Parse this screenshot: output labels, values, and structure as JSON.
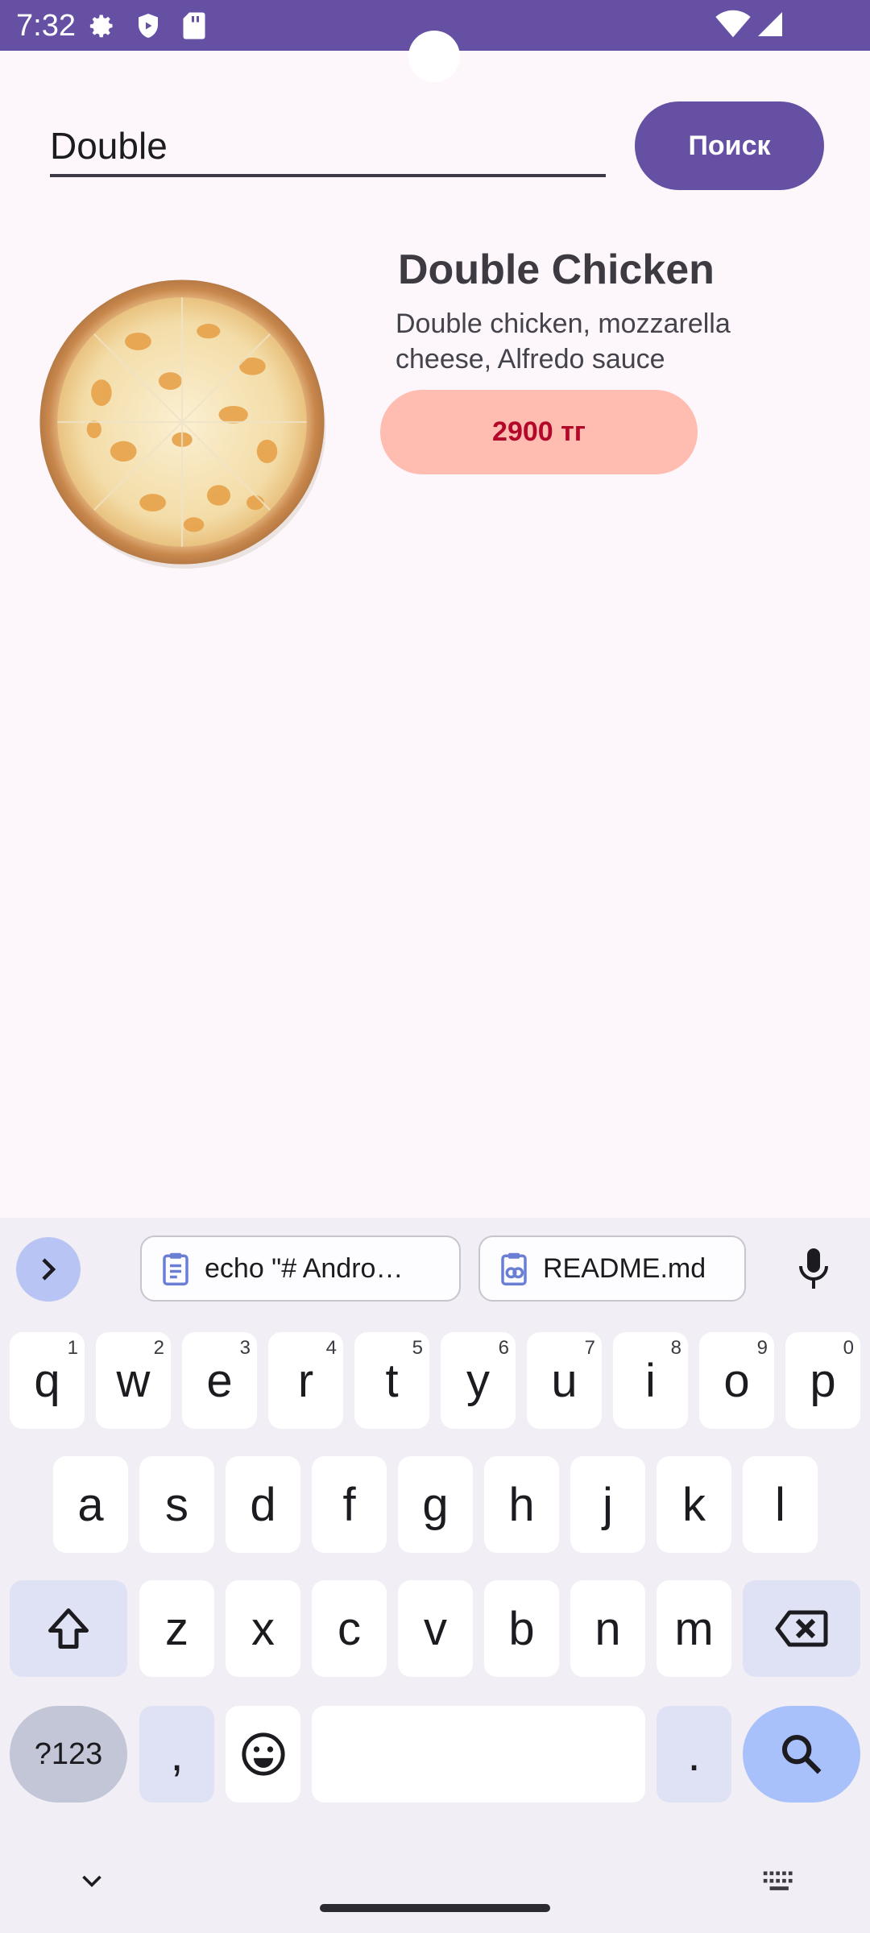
{
  "status_bar": {
    "time": "7:32",
    "icons": [
      "settings-icon",
      "shield-icon",
      "sd-card-icon",
      "wifi-icon",
      "signal-icon",
      "battery-icon"
    ]
  },
  "search": {
    "value": "Double",
    "button_label": "Поиск"
  },
  "product": {
    "title": "Double Chicken",
    "description": "Double chicken, mozzarella cheese, Alfredo sauce",
    "price": "2900 тг"
  },
  "keyboard": {
    "clipboard": [
      "echo \"# Andro…",
      "README.md"
    ],
    "row1": [
      {
        "k": "q",
        "h": "1"
      },
      {
        "k": "w",
        "h": "2"
      },
      {
        "k": "e",
        "h": "3"
      },
      {
        "k": "r",
        "h": "4"
      },
      {
        "k": "t",
        "h": "5"
      },
      {
        "k": "y",
        "h": "6"
      },
      {
        "k": "u",
        "h": "7"
      },
      {
        "k": "i",
        "h": "8"
      },
      {
        "k": "o",
        "h": "9"
      },
      {
        "k": "p",
        "h": "0"
      }
    ],
    "row2": [
      "a",
      "s",
      "d",
      "f",
      "g",
      "h",
      "j",
      "k",
      "l"
    ],
    "row3": [
      "z",
      "x",
      "c",
      "v",
      "b",
      "n",
      "m"
    ],
    "symbols_label": "?123",
    "comma": ",",
    "period": "."
  },
  "colors": {
    "primary": "#6650a4",
    "price_bg": "#ffbcb1",
    "price_text": "#b3082a",
    "background": "#fdf7fc"
  }
}
